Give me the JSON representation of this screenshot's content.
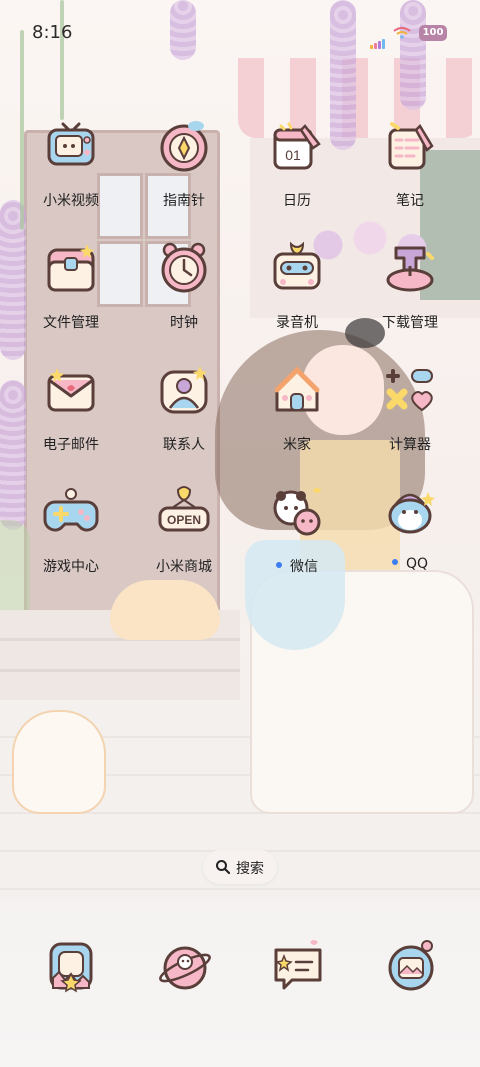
{
  "status_bar": {
    "time": "8:16",
    "battery_level": "100",
    "signal_colors": [
      "#f2b13b",
      "#ef7c9a",
      "#b07ad8",
      "#6fb8f0"
    ],
    "wifi_color": "#e86b7c",
    "battery_color": "#b784a7"
  },
  "apps": [
    {
      "label": "小米视频",
      "icon": "tv-icon"
    },
    {
      "label": "指南针",
      "icon": "compass-icon"
    },
    {
      "label": "日历",
      "icon": "calendar-icon",
      "day": "01"
    },
    {
      "label": "笔记",
      "icon": "notes-icon"
    },
    {
      "label": "文件管理",
      "icon": "folder-icon"
    },
    {
      "label": "时钟",
      "icon": "clock-icon"
    },
    {
      "label": "录音机",
      "icon": "recorder-icon"
    },
    {
      "label": "下载管理",
      "icon": "download-icon"
    },
    {
      "label": "电子邮件",
      "icon": "mail-icon"
    },
    {
      "label": "联系人",
      "icon": "contacts-icon"
    },
    {
      "label": "米家",
      "icon": "home-icon"
    },
    {
      "label": "计算器",
      "icon": "calculator-icon"
    },
    {
      "label": "游戏中心",
      "icon": "gamepad-icon"
    },
    {
      "label": "小米商城",
      "icon": "store-icon",
      "sign": "OPEN"
    },
    {
      "label": "微信",
      "icon": "wechat-icon",
      "new_dot": true
    },
    {
      "label": "QQ",
      "icon": "qq-icon",
      "new_dot": true
    }
  ],
  "search": {
    "label": "搜索",
    "icon": "search-icon"
  },
  "dock": [
    {
      "icon": "phone-icon"
    },
    {
      "icon": "browser-icon"
    },
    {
      "icon": "messages-icon"
    },
    {
      "icon": "gallery-icon"
    }
  ],
  "colors": {
    "icon_outline": "#5a3e3a",
    "pink": "#f6b8c6",
    "blue": "#a9d6ef",
    "yellow": "#fbd86a",
    "cream": "#fdf1e4",
    "notification_dot": "#3d7df2"
  }
}
